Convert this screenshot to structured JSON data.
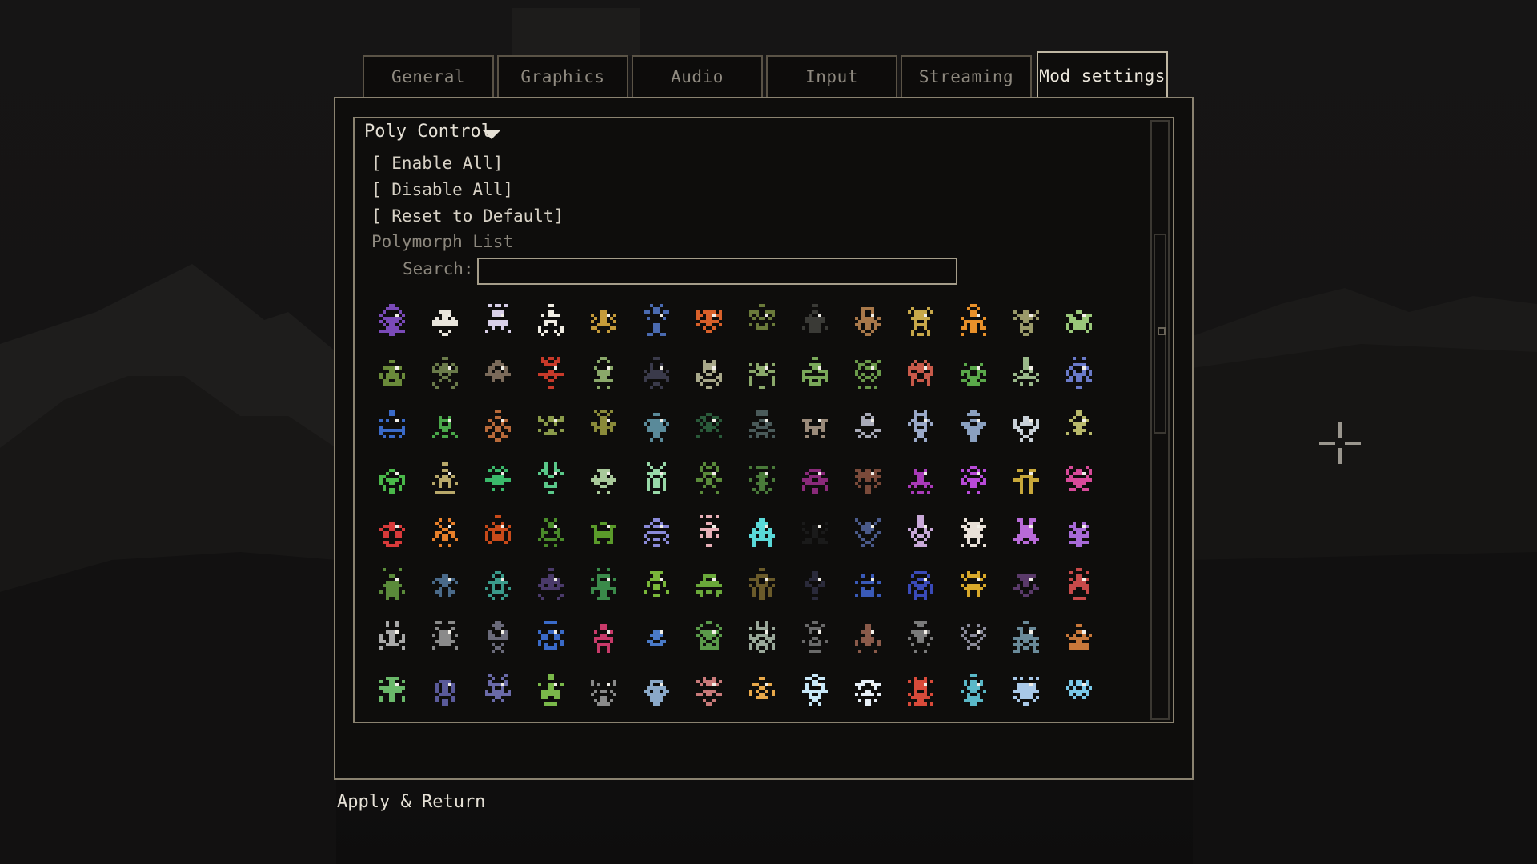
{
  "tabs": [
    {
      "label": "General",
      "active": false
    },
    {
      "label": "Graphics",
      "active": false
    },
    {
      "label": "Audio",
      "active": false
    },
    {
      "label": "Input",
      "active": false
    },
    {
      "label": "Streaming",
      "active": false
    },
    {
      "label": "Mod settings",
      "active": true
    }
  ],
  "mod": {
    "section_title": "Poly Control",
    "enable_all": "[ Enable All]",
    "disable_all": "[ Disable All]",
    "reset_default": "[ Reset to Default]",
    "list_label": "Polymorph List",
    "search_label": "Search:",
    "search_value": ""
  },
  "polymorph_grid": {
    "columns": 14,
    "rows": [
      [
        "#7a4ab8",
        "#e8e4dc",
        "#d8cfe8",
        "#f0ece2",
        "#c49a3a",
        "#4a6ab0",
        "#d8602a",
        "#6a7a3a",
        "#3a3a36",
        "#a8784a",
        "#c8a84a",
        "#e8902a",
        "#9a9a6a",
        "#9ac87a"
      ],
      [
        "#6a8a3a",
        "#6a7a4a",
        "#7a6a5a",
        "#c83a2a",
        "#8aa86a",
        "#3a3a4a",
        "#a8a88a",
        "#8aa86a",
        "#7aa85a",
        "#6a9a4a",
        "#c85a4a",
        "#5aa84a",
        "#9ab88a",
        "#6a7ac8"
      ],
      [
        "#3a6ac8",
        "#4aa84a",
        "#b86a3a",
        "#8a9a4a",
        "#8a8a3a",
        "#5a8a9a",
        "#2a5a3a",
        "#4a5a5a",
        "#9a8a7a",
        "#a8aab8",
        "#9aa8c8",
        "#8aa0c0",
        "#c8d0d8",
        "#b8b86a"
      ],
      [
        "#4ab84a",
        "#b8a86a",
        "#3ab86a",
        "#5ac88a",
        "#a8c89a",
        "#98d8a8",
        "#5a8a3a",
        "#4a7a3a",
        "#8a2a7a",
        "#7a4a3a",
        "#a83ab8",
        "#b84ad8",
        "#c8a83a",
        "#d84a9a"
      ],
      [
        "#d83a3a",
        "#e8802a",
        "#c84a1a",
        "#4a8a2a",
        "#5a9a2a",
        "#8a8ad8",
        "#e8b0b8",
        "#5ad8d8",
        "#1a1a1a",
        "#4a5a8a",
        "#c8a8d8",
        "#e8e0d8",
        "#b86ad8",
        "#a86ad8"
      ],
      [
        "#5a8a3a",
        "#4a6a8a",
        "#3a9a8a",
        "#4a3a6a",
        "#3a8a4a",
        "#7ab83a",
        "#6aa83a",
        "#6a5a2a",
        "#2a2a3a",
        "#3a5ab8",
        "#3a4ab8",
        "#d8a82a",
        "#5a3a6a",
        "#c84a4a"
      ],
      [
        "#a8a8a8",
        "#8a8a8a",
        "#6a6a7a",
        "#3a6ac8",
        "#c83a6a",
        "#4a7ac8",
        "#5a9a4a",
        "#9aa89a",
        "#6a6a6a",
        "#8a5a4a",
        "#7a7a7a",
        "#8a8a9a",
        "#6a8a9a",
        "#c8783a"
      ],
      [
        "#6ab86a",
        "#5a5a9a",
        "#6a6aa8",
        "#7ab84a",
        "#8a8a8a",
        "#8aa8c8",
        "#c87a7a",
        "#e8a84a",
        "#c8e8f8",
        "#e8f0f8",
        "#d84a3a",
        "#5ab8c8",
        "#a8c8e8",
        "#7ac8e8"
      ]
    ]
  }
}
